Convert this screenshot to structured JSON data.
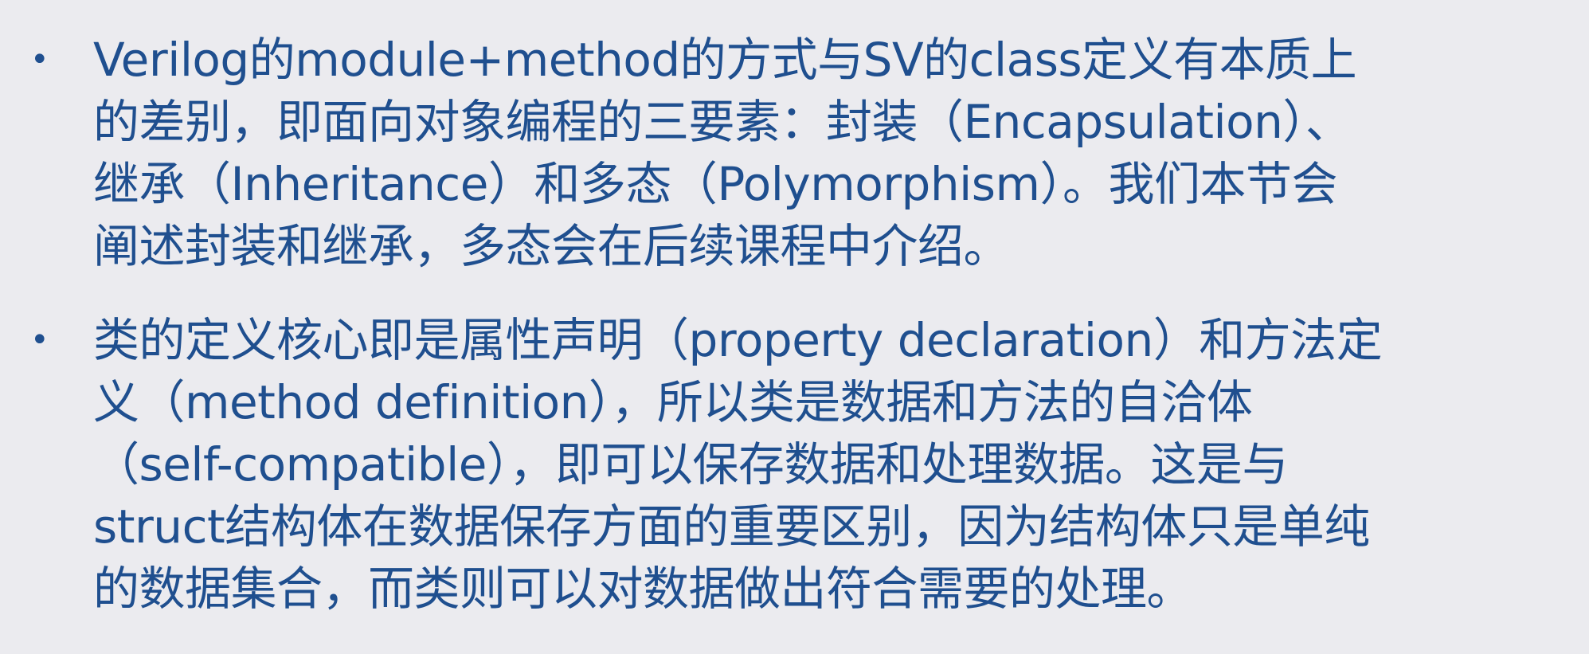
{
  "bullets": [
    {
      "symbol": "•",
      "lines": [
        "Verilog的module+method的方式与SV的class定义有本质上",
        "的差别，即面向对象编程的三要素：封装（Encapsulation）、",
        "继承（Inheritance）和多态（Polymorphism）。我们本节会",
        "阐述封装和继承，多态会在后续课程中介绍。"
      ]
    },
    {
      "symbol": "•",
      "lines": [
        "类的定义核心即是属性声明（property declaration）和方法定",
        "义（method definition），所以类是数据和方法的自洽体",
        "（self-compatible），即可以保存数据和处理数据。这是与",
        "struct结构体在数据保存方面的重要区别，因为结构体只是单纯",
        "的数据集合，而类则可以对数据做出符合需要的处理。"
      ]
    }
  ]
}
